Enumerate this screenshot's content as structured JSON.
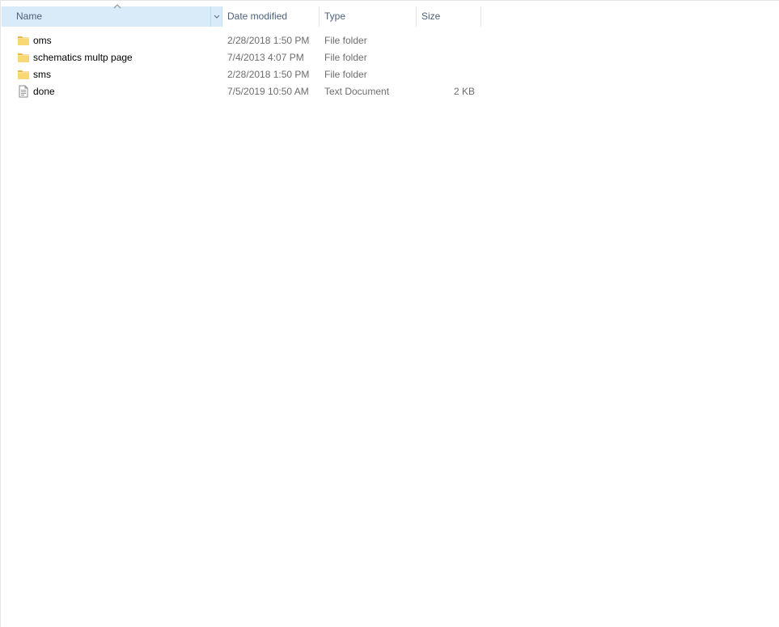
{
  "columns": {
    "name": "Name",
    "date_modified": "Date modified",
    "type": "Type",
    "size": "Size",
    "sort_indicator": "^"
  },
  "files": [
    {
      "icon": "folder-icon",
      "name": "oms",
      "date_modified": "2/28/2018 1:50 PM",
      "type": "File folder",
      "size": ""
    },
    {
      "icon": "folder-icon",
      "name": "schematics multp page",
      "date_modified": "7/4/2013 4:07 PM",
      "type": "File folder",
      "size": ""
    },
    {
      "icon": "folder-icon",
      "name": "sms",
      "date_modified": "2/28/2018 1:50 PM",
      "type": "File folder",
      "size": ""
    },
    {
      "icon": "text-document-icon",
      "name": "done",
      "date_modified": "7/5/2019 10:50 AM",
      "type": "Text Document",
      "size": "2 KB"
    }
  ],
  "colors": {
    "header_text": "#4c607a",
    "sorted_header_bg": "#d9ebf9",
    "folder_yellow": "#f8d775",
    "secondary_text": "#6d6d6d"
  }
}
